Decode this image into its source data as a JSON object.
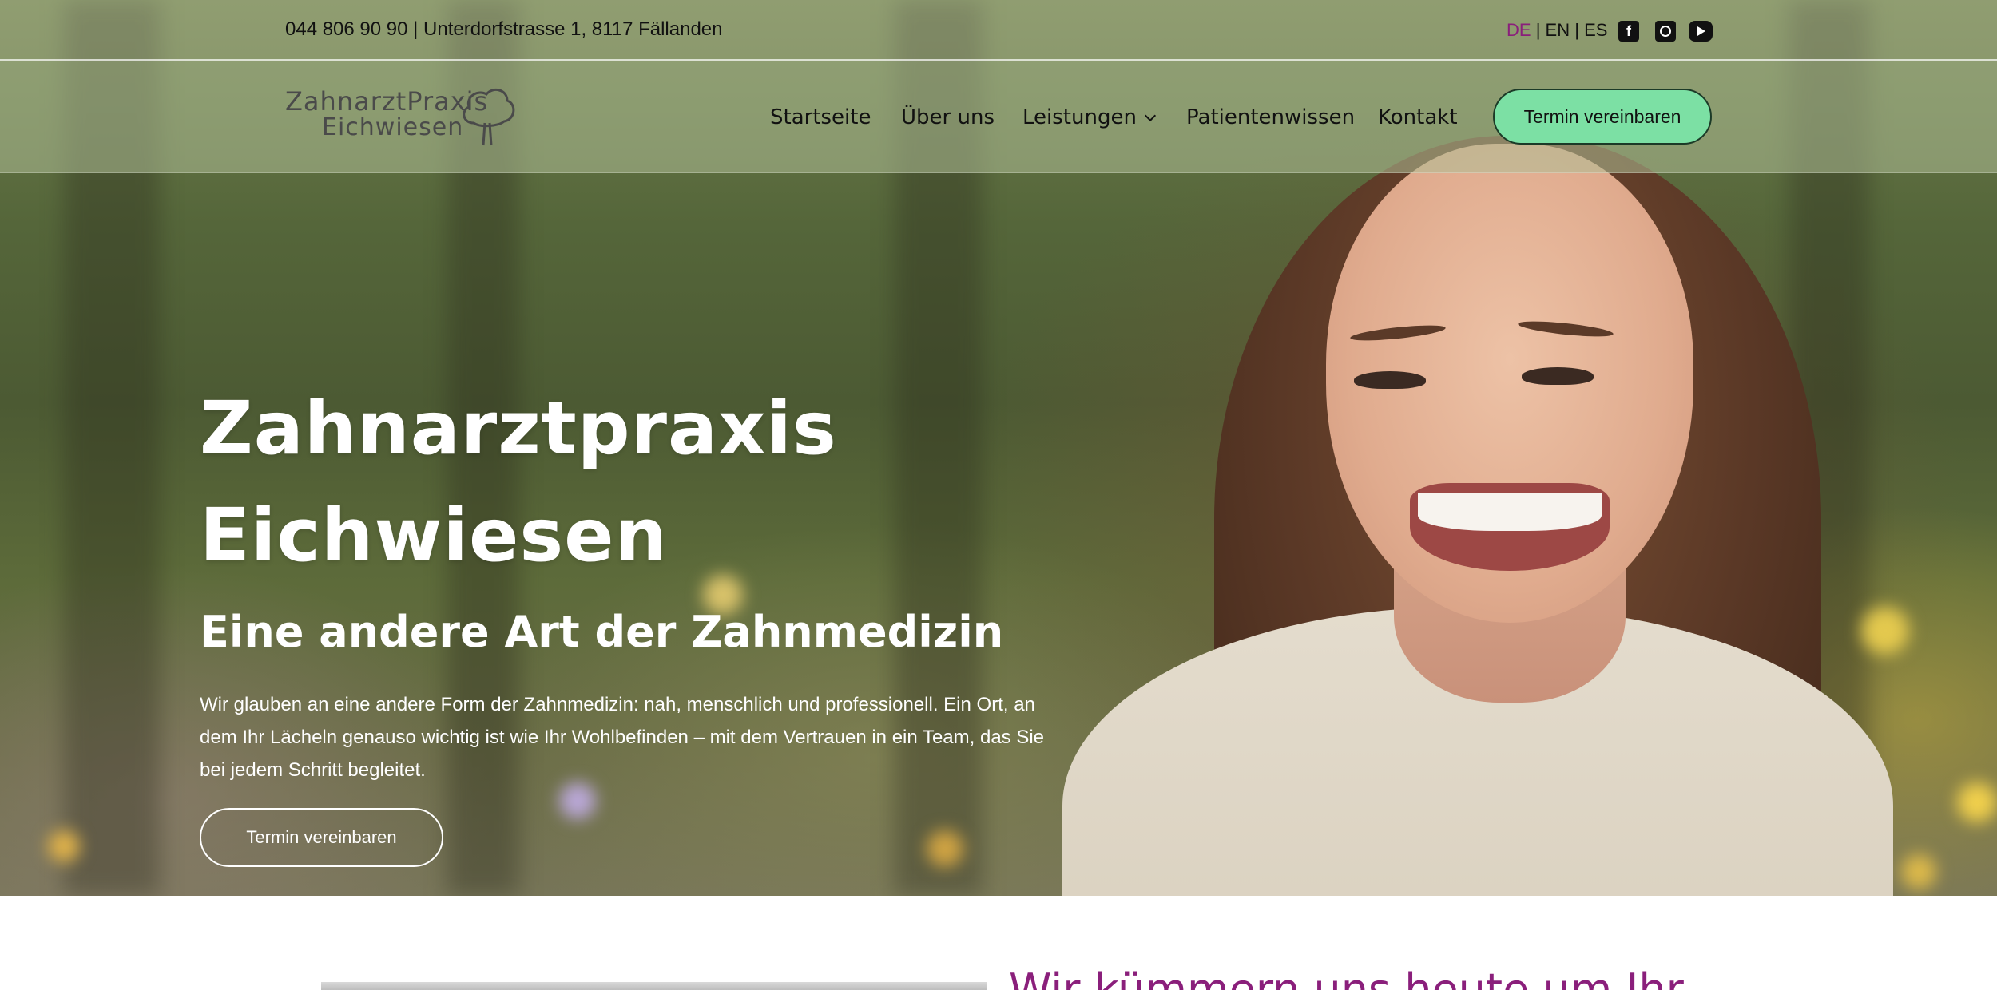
{
  "topbar": {
    "contact": "044 806 90 90 | Unterdorfstrasse 1, 8117 Fällanden",
    "languages": [
      "DE",
      "EN",
      "ES"
    ],
    "active_language": "DE",
    "social_icons": [
      "facebook-icon",
      "instagram-icon",
      "youtube-icon"
    ]
  },
  "logo": {
    "line1": "ZahnarztPraxis",
    "line2": "Eichwiesen"
  },
  "nav": {
    "items": [
      "Startseite",
      "Über uns",
      "Leistungen",
      "Patientenwissen",
      "Kontakt"
    ],
    "cta": "Termin vereinbaren"
  },
  "hero": {
    "title_line1": "Zahnarztpraxis",
    "title_line2": "Eichwiesen",
    "subtitle": "Eine andere Art der Zahnmedizin",
    "lead": "Wir glauben an eine andere Form der Zahnmedizin: nah, menschlich und professionell. Ein Ort, an dem Ihr Lächeln genauso wichtig ist wie Ihr Wohlbefinden – mit dem Vertrauen in ein Team, das Sie bei jedem Schritt begleitet.",
    "cta": "Termin vereinbaren"
  },
  "next_section": {
    "title_partial": "Wir kümmern uns heute um Ihr"
  },
  "colors": {
    "accent": "#8a1f7b",
    "cta_green": "#7ce0a4"
  }
}
